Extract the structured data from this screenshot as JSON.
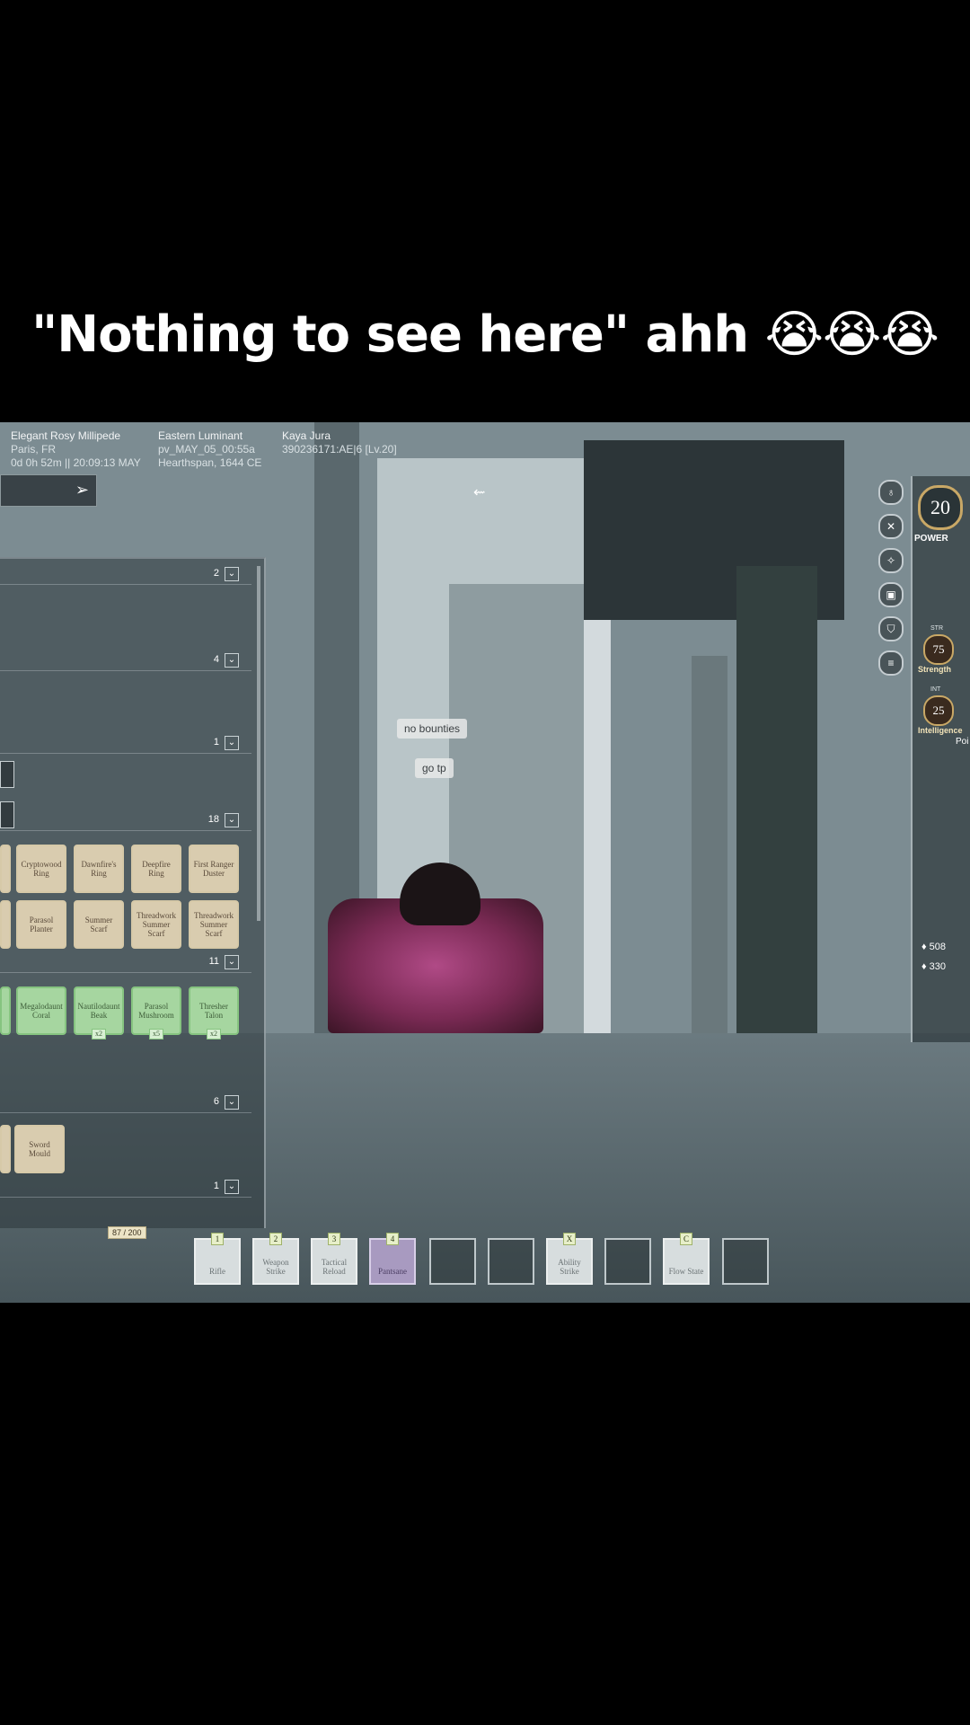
{
  "caption": {
    "text": "\"Nothing to see here\" ahh ",
    "emoji": "😭😭😭"
  },
  "hud": {
    "player_name": "Elegant Rosy Millipede",
    "location": "Paris, FR",
    "session": "0d 0h 52m || 20:09:13 MAY",
    "server_name": "Eastern Luminant",
    "server_id": "pv_MAY_05_00:55a",
    "region": "Hearthspan, 1644 CE",
    "target_name": "Kaya Jura",
    "target_id": "390236171:AE|6 [Lv.20]"
  },
  "inventory": {
    "sections": [
      {
        "count": "2"
      },
      {
        "count": "4"
      },
      {
        "count": "1"
      },
      {
        "count": "18"
      },
      {
        "count": "11"
      },
      {
        "count": "6"
      },
      {
        "count": "1"
      }
    ],
    "accessories_row1": [
      "Cryptowood Ring",
      "Dawnfire's Ring",
      "Deepfire Ring",
      "First Ranger Duster"
    ],
    "accessories_row2": [
      "Parasol Planter",
      "Summer Scarf",
      "Threadwork Summer Scarf",
      "Threadwork Summer Scarf"
    ],
    "consumables": [
      {
        "name": "Megalodaunt Coral",
        "qty": ""
      },
      {
        "name": "Nautilodaunt Beak",
        "qty": "x2"
      },
      {
        "name": "Parasol Mushroom",
        "qty": "x5"
      },
      {
        "name": "Thresher Talon",
        "qty": "x2"
      }
    ],
    "weapons": [
      "Sword Mould"
    ],
    "capacity": "87 / 200"
  },
  "hotbar": [
    {
      "key": "1",
      "label": "Rifle"
    },
    {
      "key": "2",
      "label": "Weapon Strike"
    },
    {
      "key": "3",
      "label": "Tactical Reload"
    },
    {
      "key": "4",
      "label": "Pantsane"
    },
    {
      "key": "",
      "label": ""
    },
    {
      "key": "",
      "label": ""
    },
    {
      "key": "X",
      "label": "Ability Strike"
    },
    {
      "key": "",
      "label": ""
    },
    {
      "key": "C",
      "label": "Flow State"
    },
    {
      "key": "",
      "label": ""
    }
  ],
  "world": {
    "bubble1": "no bounties",
    "bubble2": "go tp"
  },
  "stats": {
    "power": "20",
    "power_label": "POWER",
    "str_abbr": "STR",
    "str_value": "75",
    "str_name": "Strength",
    "int_abbr": "INT",
    "int_value": "25",
    "int_name": "Intelligence",
    "points_label": "Poi",
    "currency1": "508",
    "currency2": "330"
  },
  "colors": {
    "accent_gold": "#c9a866",
    "item_tan": "#d9ccaf",
    "item_green": "#a6d6a0",
    "selected_slot": "#a89ac0"
  }
}
